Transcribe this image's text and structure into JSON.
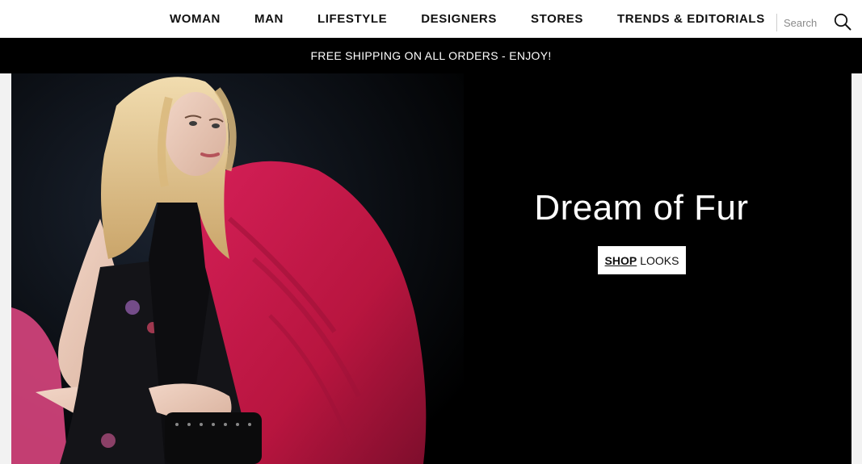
{
  "nav": {
    "items": [
      {
        "label": "WOMAN"
      },
      {
        "label": "MAN"
      },
      {
        "label": "LIFESTYLE"
      },
      {
        "label": "DESIGNERS"
      },
      {
        "label": "STORES"
      },
      {
        "label": "TRENDS & EDITORIALS"
      }
    ],
    "search_placeholder": "Search",
    "search_icon": "search-icon"
  },
  "promo": {
    "text": "FREE SHIPPING ON ALL ORDERS - ENJOY!"
  },
  "hero": {
    "title": "Dream of Fur",
    "cta_strong": "SHOP",
    "cta_rest": "LOOKS"
  },
  "colors": {
    "promo_bg": "#000000",
    "hero_bg": "#000000",
    "fur": "#c2174a",
    "hair": "#e3c48f"
  }
}
